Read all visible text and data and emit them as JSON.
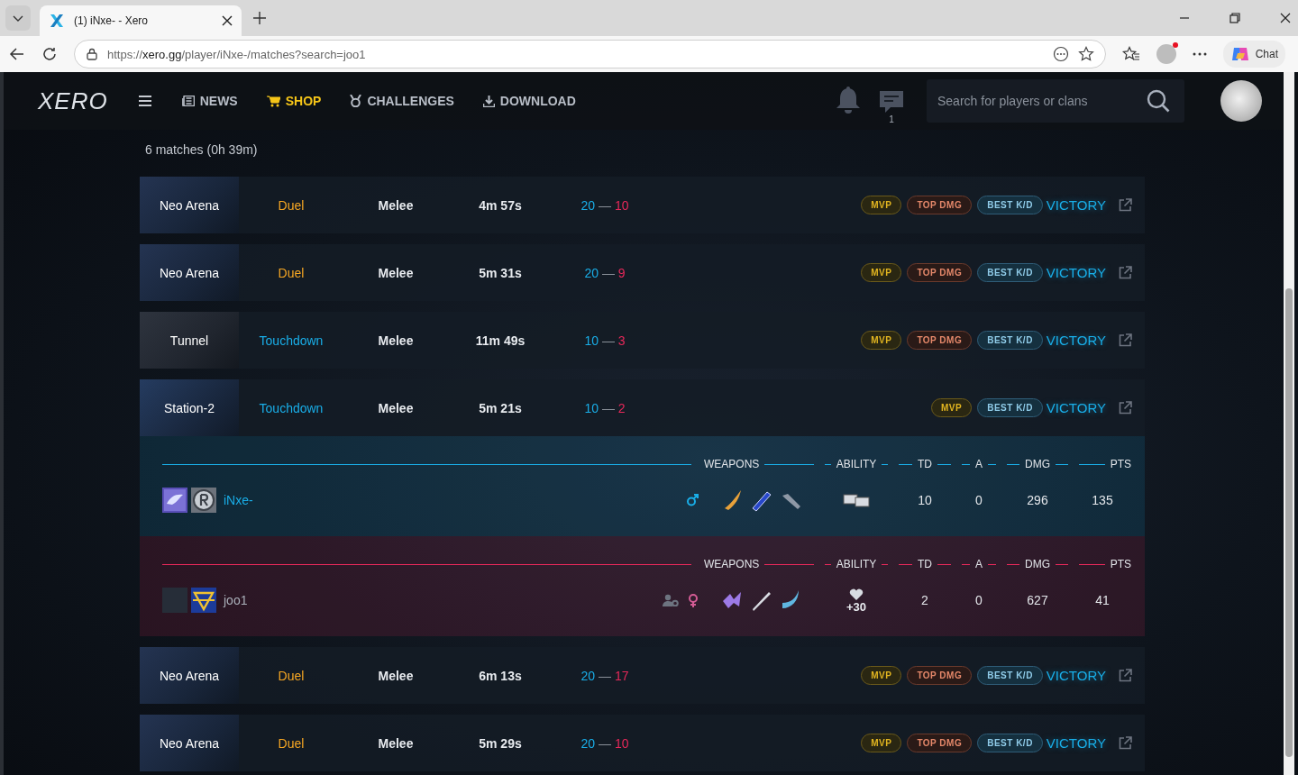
{
  "browser": {
    "tab_title": "(1) iNxe- - Xero",
    "url_host": "xero.gg",
    "url_prefix": "https://",
    "url_path": "/player/iNxe-/matches?search=joo1",
    "chat_label": "Chat"
  },
  "nav": {
    "logo": "XERO",
    "items": [
      {
        "label": "NEWS",
        "kind": "news",
        "selected": false
      },
      {
        "label": "SHOP",
        "kind": "shop",
        "selected": true
      },
      {
        "label": "CHALLENGES",
        "kind": "challenges",
        "selected": false
      },
      {
        "label": "DOWNLOAD",
        "kind": "download",
        "selected": false
      }
    ],
    "message_count": "1",
    "search": {
      "placeholder": "Search for players or clans"
    }
  },
  "summary": "6 matches (0h 39m)",
  "matches": [
    {
      "map": {
        "name": "Neo Arena",
        "kind": "arena"
      },
      "mode": {
        "label": "Duel",
        "kind": "duel"
      },
      "type": "Melee",
      "duration": "4m 57s",
      "score": {
        "team": "20",
        "separator": "—",
        "enemy": "10"
      },
      "badges": [
        {
          "kind": "mvp",
          "label": "MVP"
        },
        {
          "kind": "top_dmg",
          "label": "TOP DMG"
        },
        {
          "kind": "best_kd",
          "label": "BEST K/D"
        }
      ],
      "result": "VICTORY"
    },
    {
      "map": {
        "name": "Neo Arena",
        "kind": "arena"
      },
      "mode": {
        "label": "Duel",
        "kind": "duel"
      },
      "type": "Melee",
      "duration": "5m 31s",
      "score": {
        "team": "20",
        "separator": "—",
        "enemy": "9"
      },
      "badges": [
        {
          "kind": "mvp",
          "label": "MVP"
        },
        {
          "kind": "top_dmg",
          "label": "TOP DMG"
        },
        {
          "kind": "best_kd",
          "label": "BEST K/D"
        }
      ],
      "result": "VICTORY"
    },
    {
      "map": {
        "name": "Tunnel",
        "kind": "tunnel"
      },
      "mode": {
        "label": "Touchdown",
        "kind": "touchdown"
      },
      "type": "Melee",
      "duration": "11m 49s",
      "score": {
        "team": "10",
        "separator": "—",
        "enemy": "3"
      },
      "badges": [
        {
          "kind": "mvp",
          "label": "MVP"
        },
        {
          "kind": "top_dmg",
          "label": "TOP DMG"
        },
        {
          "kind": "best_kd",
          "label": "BEST K/D"
        }
      ],
      "result": "VICTORY"
    },
    {
      "map": {
        "name": "Station-2",
        "kind": "station"
      },
      "mode": {
        "label": "Touchdown",
        "kind": "touchdown"
      },
      "type": "Melee",
      "duration": "5m 21s",
      "score": {
        "team": "10",
        "separator": "—",
        "enemy": "2"
      },
      "badges": [
        {
          "kind": "mvp",
          "label": "MVP"
        },
        {
          "kind": "best_kd",
          "label": "BEST K/D"
        }
      ],
      "result": "VICTORY",
      "teams": [
        {
          "color": "#19aee8",
          "headers": [
            "WEAPONS",
            "ABILITY",
            "TD",
            "A",
            "DMG",
            "PTS"
          ],
          "player": {
            "name": "iNxe-",
            "emblems": [
              {
                "kind": "wing"
              },
              {
                "kind": "letter_r"
              }
            ],
            "status_icons": [
              {
                "kind": "male"
              }
            ],
            "weapons": [
              {
                "kind": "blade"
              },
              {
                "kind": "rifle"
              },
              {
                "kind": "launcher"
              }
            ],
            "ability": {
              "kind": "hp_sp"
            },
            "td": "10",
            "a": "0",
            "dmg": "296",
            "pts": "135"
          }
        },
        {
          "color": "#e8285a",
          "headers": [
            "WEAPONS",
            "ABILITY",
            "TD",
            "A",
            "DMG",
            "PTS"
          ],
          "player": {
            "name": "joo1",
            "emblems": [
              {
                "kind": "empty"
              },
              {
                "kind": "shield"
              }
            ],
            "status_icons": [
              {
                "kind": "user_gear"
              },
              {
                "kind": "female"
              }
            ],
            "weapons": [
              {
                "kind": "claw"
              },
              {
                "kind": "sword"
              },
              {
                "kind": "scythe"
              }
            ],
            "ability": {
              "kind": "heart",
              "text": "+30"
            },
            "td": "2",
            "a": "0",
            "dmg": "627",
            "pts": "41"
          }
        }
      ]
    },
    {
      "map": {
        "name": "Neo Arena",
        "kind": "arena"
      },
      "mode": {
        "label": "Duel",
        "kind": "duel"
      },
      "type": "Melee",
      "duration": "6m 13s",
      "score": {
        "team": "20",
        "separator": "—",
        "enemy": "17"
      },
      "badges": [
        {
          "kind": "mvp",
          "label": "MVP"
        },
        {
          "kind": "top_dmg",
          "label": "TOP DMG"
        },
        {
          "kind": "best_kd",
          "label": "BEST K/D"
        }
      ],
      "result": "VICTORY"
    },
    {
      "map": {
        "name": "Neo Arena",
        "kind": "arena"
      },
      "mode": {
        "label": "Duel",
        "kind": "duel"
      },
      "type": "Melee",
      "duration": "5m 29s",
      "score": {
        "team": "20",
        "separator": "—",
        "enemy": "10"
      },
      "badges": [
        {
          "kind": "mvp",
          "label": "MVP"
        },
        {
          "kind": "top_dmg",
          "label": "TOP DMG"
        },
        {
          "kind": "best_kd",
          "label": "BEST K/D"
        }
      ],
      "result": "VICTORY"
    }
  ]
}
